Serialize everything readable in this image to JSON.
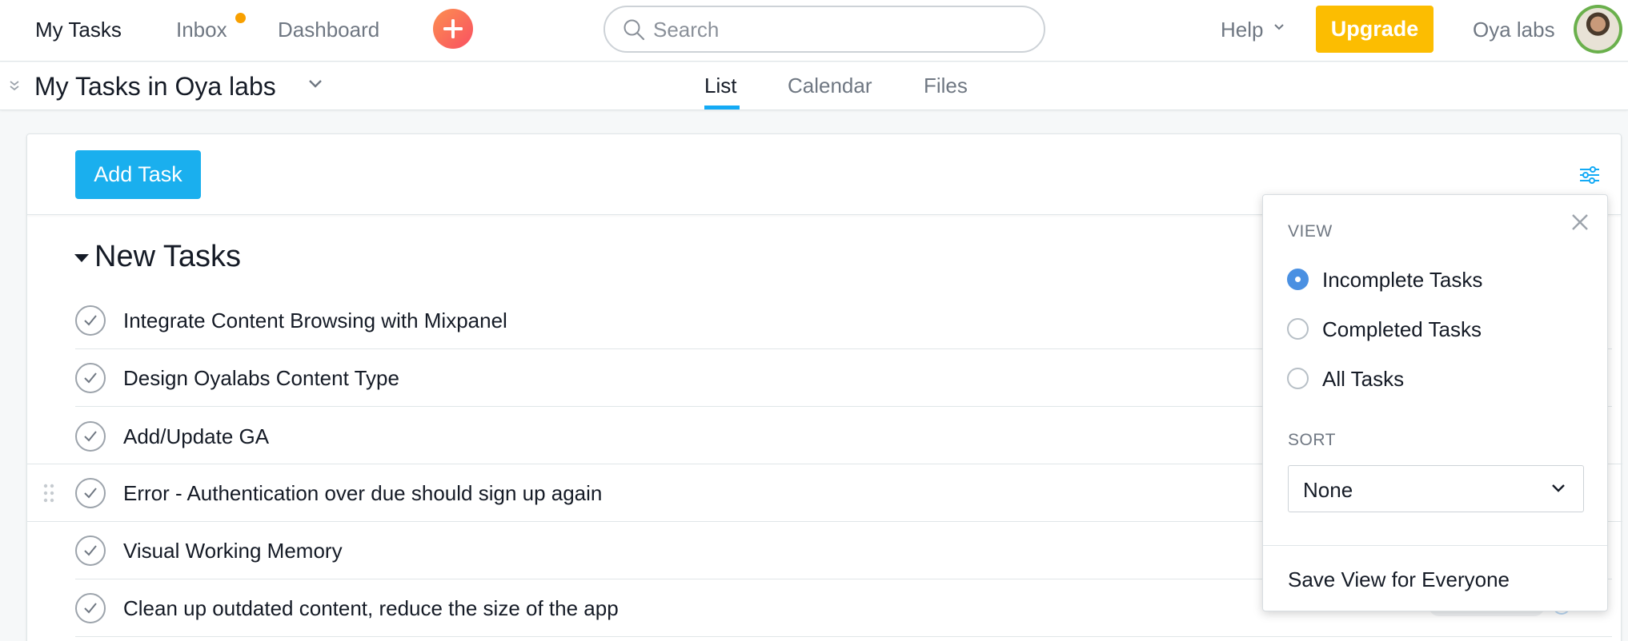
{
  "topbar": {
    "nav": [
      {
        "label": "My Tasks",
        "active": true
      },
      {
        "label": "Inbox",
        "active": false,
        "has_notification_dot": true
      },
      {
        "label": "Dashboard",
        "active": false
      }
    ],
    "quick_add_icon": "plus-icon",
    "search": {
      "placeholder": "Search",
      "value": ""
    },
    "help_label": "Help",
    "upgrade_label": "Upgrade",
    "org_name": "Oya labs",
    "colors": {
      "upgrade": "#fcbd01",
      "notification_dot": "#f8a000",
      "accent": "#14aaf5"
    }
  },
  "subbar": {
    "title": "My Tasks in Oya labs",
    "tabs": [
      {
        "label": "List",
        "active": true
      },
      {
        "label": "Calendar",
        "active": false
      },
      {
        "label": "Files",
        "active": false
      }
    ]
  },
  "toolbar": {
    "add_task_label": "Add Task",
    "filter_icon": "sliders-icon"
  },
  "section": {
    "title": "New Tasks",
    "tasks": [
      {
        "name": "Integrate Content Browsing with Mixpanel"
      },
      {
        "name": "Design Oyalabs Content Type"
      },
      {
        "name": "Add/Update GA"
      },
      {
        "name": "Error - Authentication over due should sign up again"
      },
      {
        "name": "Visual Working Memory"
      },
      {
        "name": "Clean up outdated content, reduce the size of the app"
      }
    ]
  },
  "view_panel": {
    "view_label": "VIEW",
    "view_options": [
      {
        "label": "Incomplete Tasks",
        "selected": true
      },
      {
        "label": "Completed Tasks",
        "selected": false
      },
      {
        "label": "All Tasks",
        "selected": false
      }
    ],
    "sort_label": "SORT",
    "sort_value": "None",
    "save_view_label": "Save View for Everyone"
  }
}
